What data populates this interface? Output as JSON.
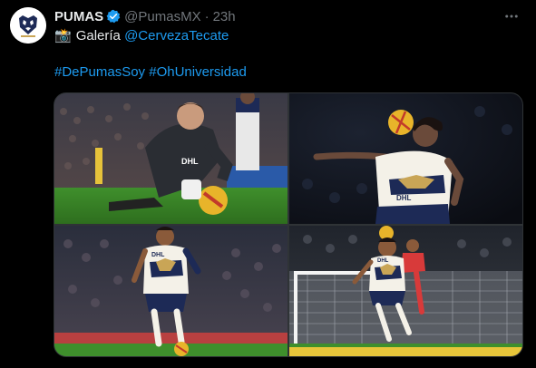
{
  "post": {
    "author_name": "PUMAS",
    "handle": "@PumasMX",
    "separator": "·",
    "time": "23h",
    "text_prefix": "Galería",
    "text_mention": "@CervezaTecate",
    "hashtag_1": "#DePumasSoy",
    "hashtag_2": "#OhUniversidad"
  },
  "media": {
    "photos": [
      {
        "sponsor_text": "DHL"
      },
      {
        "sponsor_text": "DHL"
      },
      {
        "sponsor_text": "DHL"
      },
      {
        "sponsor_text": "DHL"
      }
    ]
  },
  "icons": {
    "avatar": "pumas-logo-icon",
    "verified": "verified-badge-icon",
    "more": "more-options-icon",
    "camera": "camera-emoji-icon"
  },
  "colors": {
    "background": "#000000",
    "text": "#e7e9ea",
    "muted": "#71767b",
    "link": "#1d9bf0",
    "verified": "#1d9bf0",
    "pumas_navy": "#1d2a56",
    "pumas_gold": "#c9a556"
  }
}
